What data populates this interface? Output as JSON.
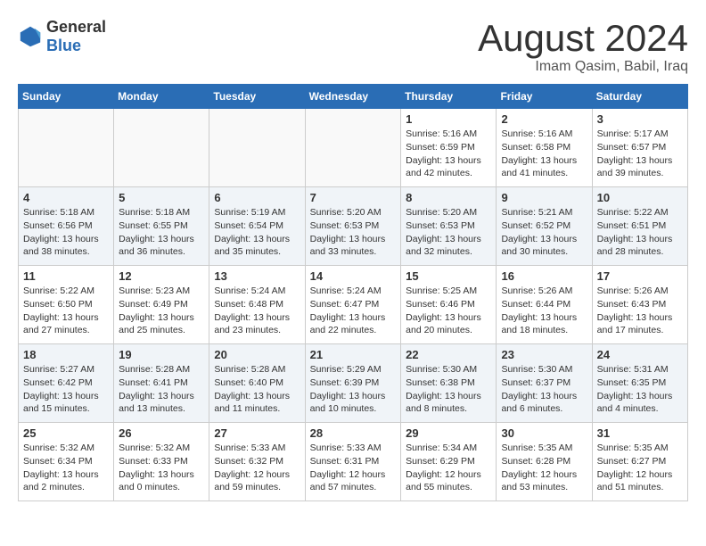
{
  "header": {
    "logo": {
      "general": "General",
      "blue": "Blue"
    },
    "title": "August 2024",
    "location": "Imam Qasim, Babil, Iraq"
  },
  "columns": [
    "Sunday",
    "Monday",
    "Tuesday",
    "Wednesday",
    "Thursday",
    "Friday",
    "Saturday"
  ],
  "weeks": [
    [
      {
        "day": "",
        "info": ""
      },
      {
        "day": "",
        "info": ""
      },
      {
        "day": "",
        "info": ""
      },
      {
        "day": "",
        "info": ""
      },
      {
        "day": "1",
        "info": "Sunrise: 5:16 AM\nSunset: 6:59 PM\nDaylight: 13 hours\nand 42 minutes."
      },
      {
        "day": "2",
        "info": "Sunrise: 5:16 AM\nSunset: 6:58 PM\nDaylight: 13 hours\nand 41 minutes."
      },
      {
        "day": "3",
        "info": "Sunrise: 5:17 AM\nSunset: 6:57 PM\nDaylight: 13 hours\nand 39 minutes."
      }
    ],
    [
      {
        "day": "4",
        "info": "Sunrise: 5:18 AM\nSunset: 6:56 PM\nDaylight: 13 hours\nand 38 minutes."
      },
      {
        "day": "5",
        "info": "Sunrise: 5:18 AM\nSunset: 6:55 PM\nDaylight: 13 hours\nand 36 minutes."
      },
      {
        "day": "6",
        "info": "Sunrise: 5:19 AM\nSunset: 6:54 PM\nDaylight: 13 hours\nand 35 minutes."
      },
      {
        "day": "7",
        "info": "Sunrise: 5:20 AM\nSunset: 6:53 PM\nDaylight: 13 hours\nand 33 minutes."
      },
      {
        "day": "8",
        "info": "Sunrise: 5:20 AM\nSunset: 6:53 PM\nDaylight: 13 hours\nand 32 minutes."
      },
      {
        "day": "9",
        "info": "Sunrise: 5:21 AM\nSunset: 6:52 PM\nDaylight: 13 hours\nand 30 minutes."
      },
      {
        "day": "10",
        "info": "Sunrise: 5:22 AM\nSunset: 6:51 PM\nDaylight: 13 hours\nand 28 minutes."
      }
    ],
    [
      {
        "day": "11",
        "info": "Sunrise: 5:22 AM\nSunset: 6:50 PM\nDaylight: 13 hours\nand 27 minutes."
      },
      {
        "day": "12",
        "info": "Sunrise: 5:23 AM\nSunset: 6:49 PM\nDaylight: 13 hours\nand 25 minutes."
      },
      {
        "day": "13",
        "info": "Sunrise: 5:24 AM\nSunset: 6:48 PM\nDaylight: 13 hours\nand 23 minutes."
      },
      {
        "day": "14",
        "info": "Sunrise: 5:24 AM\nSunset: 6:47 PM\nDaylight: 13 hours\nand 22 minutes."
      },
      {
        "day": "15",
        "info": "Sunrise: 5:25 AM\nSunset: 6:46 PM\nDaylight: 13 hours\nand 20 minutes."
      },
      {
        "day": "16",
        "info": "Sunrise: 5:26 AM\nSunset: 6:44 PM\nDaylight: 13 hours\nand 18 minutes."
      },
      {
        "day": "17",
        "info": "Sunrise: 5:26 AM\nSunset: 6:43 PM\nDaylight: 13 hours\nand 17 minutes."
      }
    ],
    [
      {
        "day": "18",
        "info": "Sunrise: 5:27 AM\nSunset: 6:42 PM\nDaylight: 13 hours\nand 15 minutes."
      },
      {
        "day": "19",
        "info": "Sunrise: 5:28 AM\nSunset: 6:41 PM\nDaylight: 13 hours\nand 13 minutes."
      },
      {
        "day": "20",
        "info": "Sunrise: 5:28 AM\nSunset: 6:40 PM\nDaylight: 13 hours\nand 11 minutes."
      },
      {
        "day": "21",
        "info": "Sunrise: 5:29 AM\nSunset: 6:39 PM\nDaylight: 13 hours\nand 10 minutes."
      },
      {
        "day": "22",
        "info": "Sunrise: 5:30 AM\nSunset: 6:38 PM\nDaylight: 13 hours\nand 8 minutes."
      },
      {
        "day": "23",
        "info": "Sunrise: 5:30 AM\nSunset: 6:37 PM\nDaylight: 13 hours\nand 6 minutes."
      },
      {
        "day": "24",
        "info": "Sunrise: 5:31 AM\nSunset: 6:35 PM\nDaylight: 13 hours\nand 4 minutes."
      }
    ],
    [
      {
        "day": "25",
        "info": "Sunrise: 5:32 AM\nSunset: 6:34 PM\nDaylight: 13 hours\nand 2 minutes."
      },
      {
        "day": "26",
        "info": "Sunrise: 5:32 AM\nSunset: 6:33 PM\nDaylight: 13 hours\nand 0 minutes."
      },
      {
        "day": "27",
        "info": "Sunrise: 5:33 AM\nSunset: 6:32 PM\nDaylight: 12 hours\nand 59 minutes."
      },
      {
        "day": "28",
        "info": "Sunrise: 5:33 AM\nSunset: 6:31 PM\nDaylight: 12 hours\nand 57 minutes."
      },
      {
        "day": "29",
        "info": "Sunrise: 5:34 AM\nSunset: 6:29 PM\nDaylight: 12 hours\nand 55 minutes."
      },
      {
        "day": "30",
        "info": "Sunrise: 5:35 AM\nSunset: 6:28 PM\nDaylight: 12 hours\nand 53 minutes."
      },
      {
        "day": "31",
        "info": "Sunrise: 5:35 AM\nSunset: 6:27 PM\nDaylight: 12 hours\nand 51 minutes."
      }
    ]
  ]
}
